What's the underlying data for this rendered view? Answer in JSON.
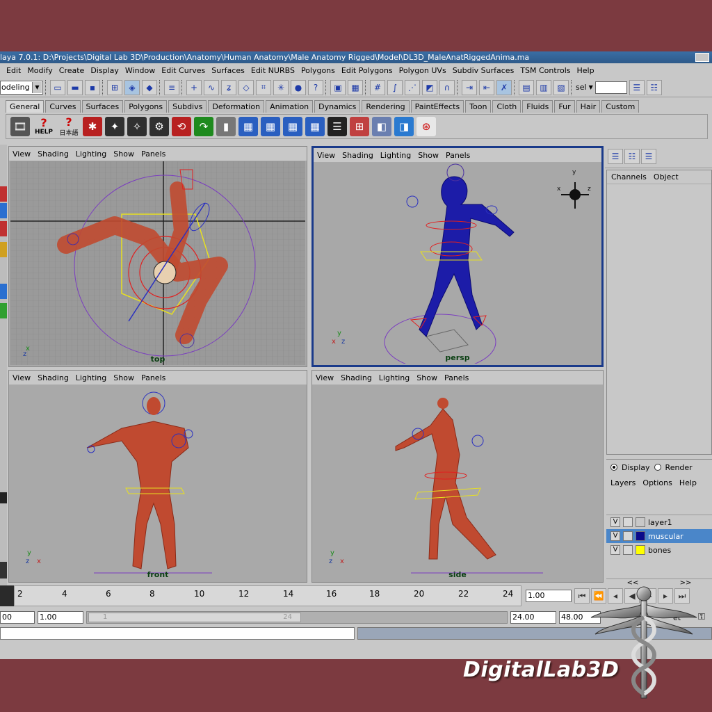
{
  "window": {
    "title": "laya 7.0.1: D:\\Projects\\Digital Lab 3D\\Production\\Anatomy\\Human Anatomy\\Male Anatomy Rigged\\Model\\DL3D_MaleAnatRiggedAnima.ma"
  },
  "menu": [
    "Edit",
    "Modify",
    "Create",
    "Display",
    "Window",
    "Edit Curves",
    "Surfaces",
    "Edit NURBS",
    "Polygons",
    "Edit Polygons",
    "Polygon UVs",
    "Subdiv Surfaces",
    "TSM Controls",
    "Help"
  ],
  "status": {
    "mode": "odeling",
    "select_label": "sel"
  },
  "shelf_tabs": [
    "General",
    "Curves",
    "Surfaces",
    "Polygons",
    "Subdivs",
    "Deformation",
    "Animation",
    "Dynamics",
    "Rendering",
    "PaintEffects",
    "Toon",
    "Cloth",
    "Fluids",
    "Fur",
    "Hair",
    "Custom"
  ],
  "shelf_icons": [
    "clapper-icon",
    "help-icon",
    "joint-icon",
    "ik-handle-icon",
    "ik-spline-icon",
    "skin-bind-icon",
    "detach-skin-icon",
    "go-to-bind-pose-icon",
    "set-key-icon",
    "graph-editor-icon",
    "dope-sheet-icon",
    "trax-icon",
    "blend-shape-icon",
    "outliner-icon",
    "hypershade-icon",
    "render-icon",
    "ipr-icon",
    "paint-weights-icon"
  ],
  "shelf_help_label": "HELP",
  "shelf_lang_label": "日本語",
  "viewports": {
    "menu": [
      "View",
      "Shading",
      "Lighting",
      "Show",
      "Panels"
    ],
    "top": "top",
    "persp": "persp",
    "front": "front",
    "side": "side"
  },
  "axes": {
    "x": "x",
    "y": "y",
    "z": "z"
  },
  "channel_box": {
    "tabs": [
      "Channels",
      "Object"
    ]
  },
  "layers": {
    "display_label": "Display",
    "render_label": "Render",
    "menu": [
      "Layers",
      "Options",
      "Help"
    ],
    "items": [
      {
        "vis": "V",
        "name": "layer1",
        "color": "",
        "selected": false
      },
      {
        "vis": "V",
        "name": "muscular",
        "color": "#0a0a8a",
        "selected": true
      },
      {
        "vis": "V",
        "name": "bones",
        "color": "#ffff00",
        "selected": false
      }
    ],
    "scroll_left": "<<",
    "scroll_right": ">>"
  },
  "timeline": {
    "labels": [
      "2",
      "4",
      "6",
      "8",
      "10",
      "12",
      "14",
      "16",
      "18",
      "20",
      "22",
      "24"
    ],
    "current_time": "1.00"
  },
  "range": {
    "start": "00",
    "playback_start": "1.00",
    "slider_start": "1",
    "slider_end": "24",
    "playback_end": "24.00",
    "end": "48.00",
    "set_label": "et"
  },
  "watermark": "DigitalLab3D"
}
